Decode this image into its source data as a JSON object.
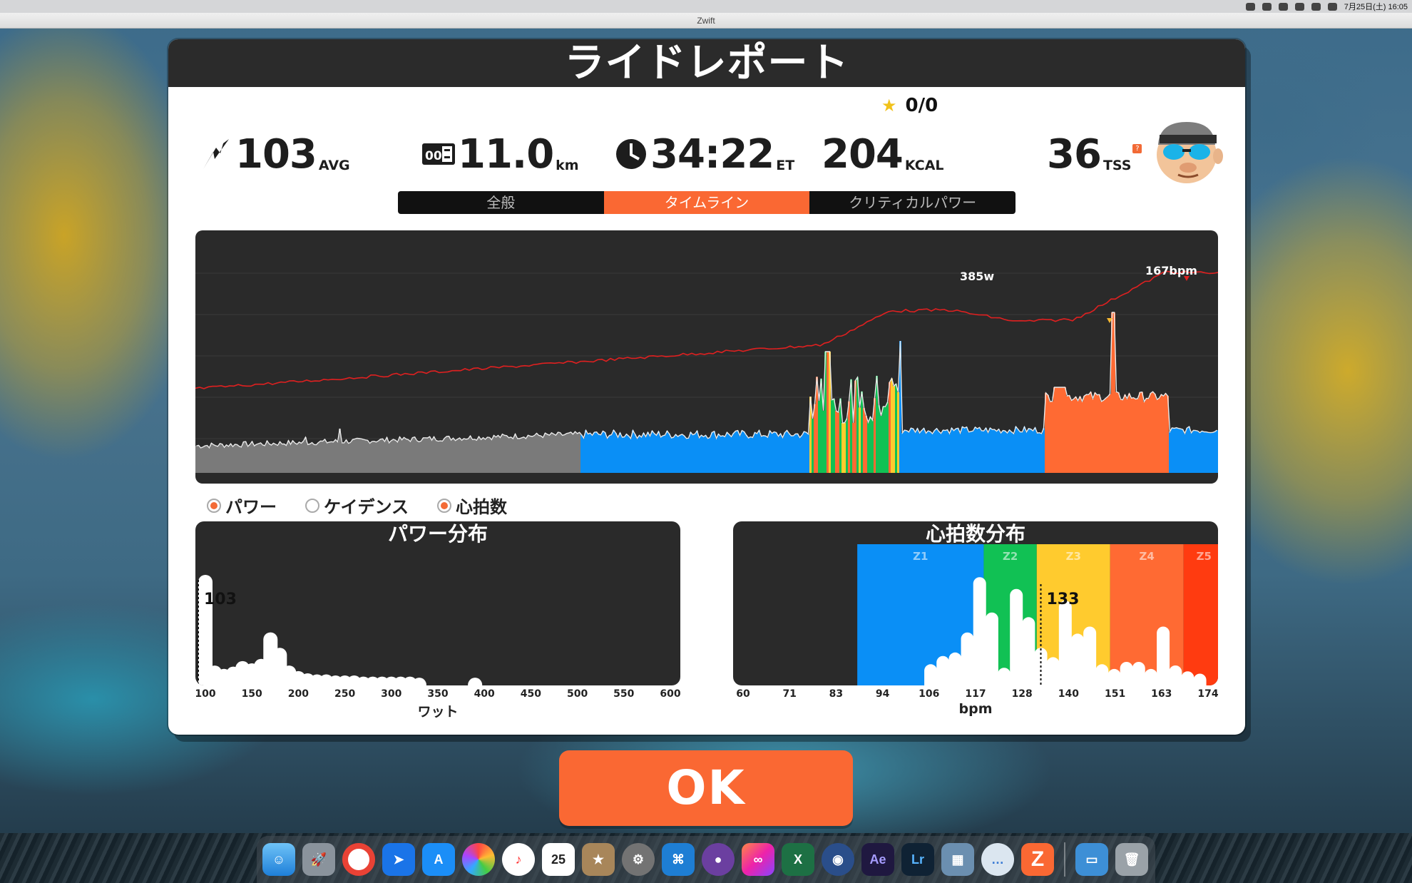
{
  "menubar": {
    "datetime": "7月25日(土) 16:05"
  },
  "window": {
    "title": "Zwift"
  },
  "panel": {
    "title": "ライドレポート"
  },
  "stars": {
    "value": "0/0"
  },
  "stats": {
    "power": {
      "value": "103",
      "unit": "AVG"
    },
    "distance": {
      "value": "11.0",
      "unit": "km"
    },
    "time": {
      "value": "34:22",
      "unit": "ET"
    },
    "calories": {
      "value": "204",
      "unit": "KCAL"
    },
    "tss": {
      "value": "36",
      "unit": "TSS",
      "help": "?"
    }
  },
  "tabs": [
    {
      "label": "全般"
    },
    {
      "label": "タイムライン",
      "active": true
    },
    {
      "label": "クリティカルパワー"
    }
  ],
  "timeline": {
    "max_hr_label": "167bpm",
    "max_power_label": "385w"
  },
  "legend": [
    {
      "label": "パワー",
      "checked": true
    },
    {
      "label": "ケイデンス",
      "checked": false
    },
    {
      "label": "心拍数",
      "checked": true
    }
  ],
  "colors": {
    "accent": "#fa6833",
    "hr_line": "#e02020",
    "z1": "#0a8ff6",
    "z2": "#11c154",
    "z3": "#ffcb2e",
    "z4": "#ff6a33",
    "z5": "#ff3b10",
    "low_power": "#7a7a7a"
  },
  "power_dist": {
    "title": "パワー分布",
    "avg_label": "103",
    "ticks": [
      "100",
      "150",
      "200",
      "250",
      "300",
      "350",
      "400",
      "450",
      "500",
      "550",
      "600"
    ],
    "axis_title": "ワット"
  },
  "hr_dist": {
    "title": "心拍数分布",
    "avg_label": "133",
    "zones": [
      "Z1",
      "Z2",
      "Z3",
      "Z4",
      "Z5"
    ],
    "ticks": [
      "60",
      "71",
      "83",
      "94",
      "106",
      "117",
      "128",
      "140",
      "151",
      "163",
      "174"
    ],
    "axis_title": "bpm"
  },
  "ok_button": {
    "label": "OK"
  },
  "chart_data": [
    {
      "type": "bar",
      "x": [
        100,
        110,
        120,
        130,
        140,
        150,
        160,
        170,
        180,
        190,
        200,
        210,
        220,
        230,
        240,
        250,
        260,
        270,
        280,
        290,
        300,
        310,
        320,
        330,
        340,
        350,
        360,
        370,
        380,
        390,
        400
      ],
      "values": [
        1.0,
        0.18,
        0.15,
        0.17,
        0.22,
        0.2,
        0.24,
        0.48,
        0.34,
        0.18,
        0.13,
        0.11,
        0.1,
        0.1,
        0.09,
        0.09,
        0.09,
        0.08,
        0.08,
        0.08,
        0.08,
        0.08,
        0.08,
        0.07,
        0,
        0,
        0,
        0,
        0,
        0.07,
        0
      ],
      "title": "パワー分布",
      "xlabel": "ワット",
      "ylim": [
        0,
        1
      ]
    },
    {
      "type": "bar",
      "x": [
        106,
        109,
        112,
        115,
        118,
        121,
        124,
        127,
        130,
        133,
        136,
        139,
        142,
        145,
        148,
        151,
        154,
        157,
        160,
        163,
        166,
        169,
        172
      ],
      "values": [
        0.18,
        0.25,
        0.28,
        0.45,
        0.92,
        0.62,
        0.15,
        0.82,
        0.58,
        0.32,
        0.24,
        0.72,
        0.44,
        0.5,
        0.18,
        0.14,
        0.2,
        0.2,
        0.14,
        0.5,
        0.17,
        0.12,
        0.1
      ],
      "title": "心拍数分布",
      "xlabel": "bpm",
      "ylim": [
        0,
        1
      ]
    }
  ]
}
